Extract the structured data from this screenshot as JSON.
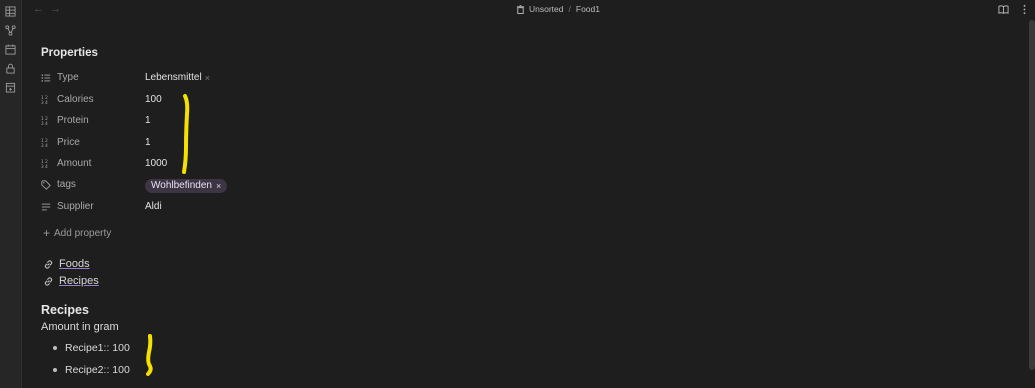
{
  "breadcrumb": {
    "folder": "Unsorted",
    "separator": "/",
    "file": "Food1"
  },
  "ribbon_icons": [
    "table-icon",
    "graph-icon",
    "calendar-icon",
    "lock-icon",
    "template-icon"
  ],
  "properties": {
    "title": "Properties",
    "rows": [
      {
        "key": "Type",
        "icon": "list-icon",
        "value": "Lebensmittel",
        "has_remove": true
      },
      {
        "key": "Calories",
        "icon": "number-icon",
        "value": "100"
      },
      {
        "key": "Protein",
        "icon": "number-icon",
        "value": "1"
      },
      {
        "key": "Price",
        "icon": "number-icon",
        "value": "1"
      },
      {
        "key": "Amount",
        "icon": "number-icon",
        "value": "1000"
      },
      {
        "key": "tags",
        "icon": "tag-icon",
        "tag": "Wohlbefinden"
      },
      {
        "key": "Supplier",
        "icon": "text-icon",
        "value": "Aldi"
      }
    ],
    "add_label": "Add property",
    "remove_mark": "×"
  },
  "links": [
    "Foods",
    "Recipes"
  ],
  "recipes": {
    "heading": "Recipes",
    "subtitle": "Amount in gram",
    "items": [
      "Recipe1:: 100",
      "Recipe2:: 100"
    ]
  },
  "colors": {
    "background": "#1e1e1e",
    "tag_bg": "#3d3544",
    "highlight": "#f5e000",
    "link_underline": "#9a7fcc"
  }
}
